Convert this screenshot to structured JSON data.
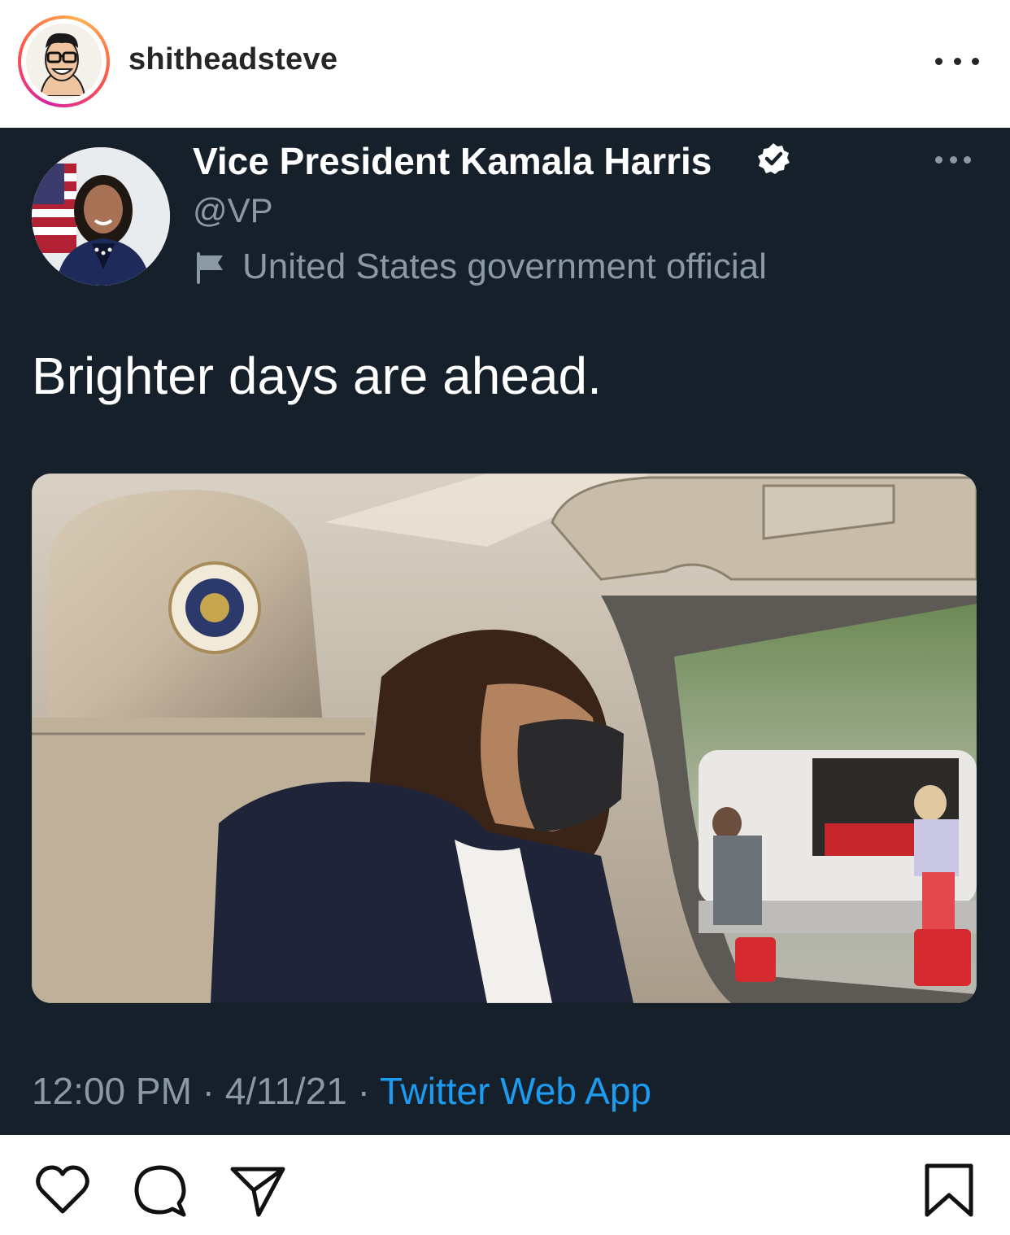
{
  "post": {
    "username": "shitheadsteve"
  },
  "tweet": {
    "display_name": "Vice President Kamala Harris",
    "handle": "@VP",
    "label": "United States government official",
    "text": "Brighter days are ahead.",
    "time": "12:00 PM",
    "date": "4/11/21",
    "source": "Twitter Web App",
    "separator": " · "
  },
  "colors": {
    "tweet_bg": "#15202b",
    "muted": "#8b98a5",
    "link": "#1d9bf0",
    "ig_text": "#262626"
  },
  "icons": [
    "more-icon",
    "verified-badge-icon",
    "flag-icon",
    "heart-icon",
    "comment-icon",
    "share-icon",
    "bookmark-icon"
  ]
}
